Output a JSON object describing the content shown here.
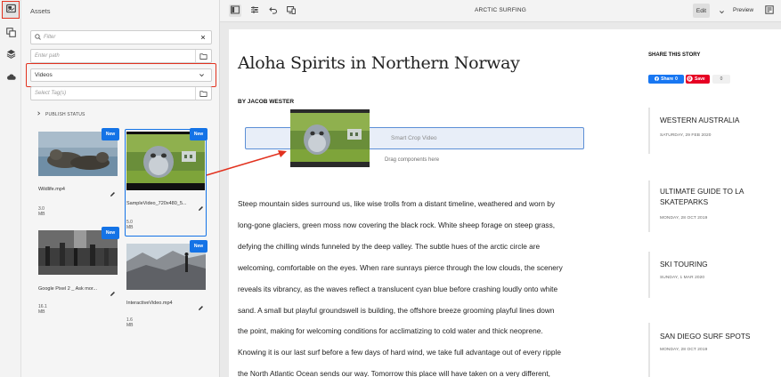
{
  "toolbar": {
    "document_title": "ARCTIC SURFING",
    "edit_label": "Edit",
    "preview_label": "Preview"
  },
  "assets_panel": {
    "title": "Assets",
    "filter_placeholder": "Filter",
    "path_placeholder": "Enter path",
    "type_selected": "Videos",
    "tags_placeholder": "Select Tag(s)",
    "publish_status_label": "PUBLISH STATUS",
    "items": [
      {
        "name": "Wildlife.mp4",
        "size": "3.0 MB",
        "badge": "New"
      },
      {
        "name": "SampleVideo_720x480_5...",
        "size": "5.0 MB",
        "badge": "New"
      },
      {
        "name": "Google Pixel 2 _ Ask mor...",
        "size": "16.1 MB",
        "badge": "New"
      },
      {
        "name": "InteractiveVideo.mp4",
        "size": "1.6 MB",
        "badge": "New"
      }
    ]
  },
  "article": {
    "title": "Aloha Spirits in Northern Norway",
    "byline": "BY JACOB WESTER",
    "dropzone_label": "Smart Crop Video",
    "drag_hint": "Drag components here",
    "body_lines": [
      "Steep mountain sides surround us, like wise trolls from a distant timeline, weathered and worn by",
      "long-gone glaciers, green moss now covering the black rock. White sheep forage on steep grass,",
      "defying the chilling winds funneled by the deep valley. The subtle hues of the arctic circle are",
      "welcoming, comfortable on the eyes. When rare sunrays pierce through the low clouds, the scenery",
      "reveals its vibrancy, as the waves reflect a translucent cyan blue before crashing loudly onto white",
      "sand. A small but playful groundswell is building, the offshore breeze grooming playful lines down",
      "the point, making for welcoming conditions for acclimatizing to cold water and thick neoprene.",
      "Knowing it is our last surf before a few days of hard wind, we take full advantage out of every ripple",
      "the North Atlantic Ocean sends our way. Tomorrow this place will have taken on a very different,"
    ]
  },
  "share": {
    "heading": "SHARE THIS STORY",
    "facebook_label": "Share",
    "facebook_count": "0",
    "pinterest_label": "Save",
    "pinterest_count": "0"
  },
  "stories": [
    {
      "title": "WESTERN AUSTRALIA",
      "date": "SATURDAY, 29 FEB 2020"
    },
    {
      "title": "ULTIMATE GUIDE TO LA SKATEPARKS",
      "date": "MONDAY, 28 OCT 2019"
    },
    {
      "title": "SKI TOURING",
      "date": "SUNDAY, 1 MAR 2020"
    },
    {
      "title": "SAN DIEGO SURF SPOTS",
      "date": "MONDAY, 28 OCT 2019"
    }
  ],
  "colors": {
    "accent_blue": "#1473e6",
    "highlight_red": "#e2321f"
  }
}
